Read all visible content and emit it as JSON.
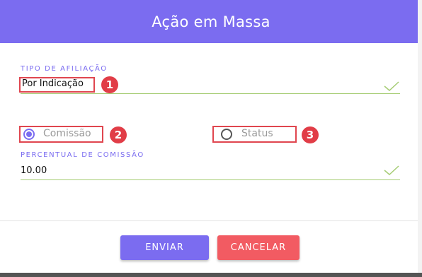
{
  "header": {
    "title": "Ação em Massa"
  },
  "affiliation": {
    "label": "TIPO DE AFILIAÇÃO",
    "value": "Por Indicação",
    "badge": "1"
  },
  "mode": {
    "options": [
      {
        "label": "Comissão",
        "selected": true,
        "badge": "2"
      },
      {
        "label": "Status",
        "selected": false,
        "badge": "3"
      }
    ]
  },
  "commission": {
    "label": "PERCENTUAL DE COMISSÃO",
    "value": "10.00"
  },
  "footer": {
    "submit_label": "ENVIAR",
    "cancel_label": "CANCELAR"
  },
  "colors": {
    "accent": "#7b6cf0",
    "danger": "#f25b62",
    "annotation": "#e13d47",
    "valid": "#a5cc73"
  }
}
